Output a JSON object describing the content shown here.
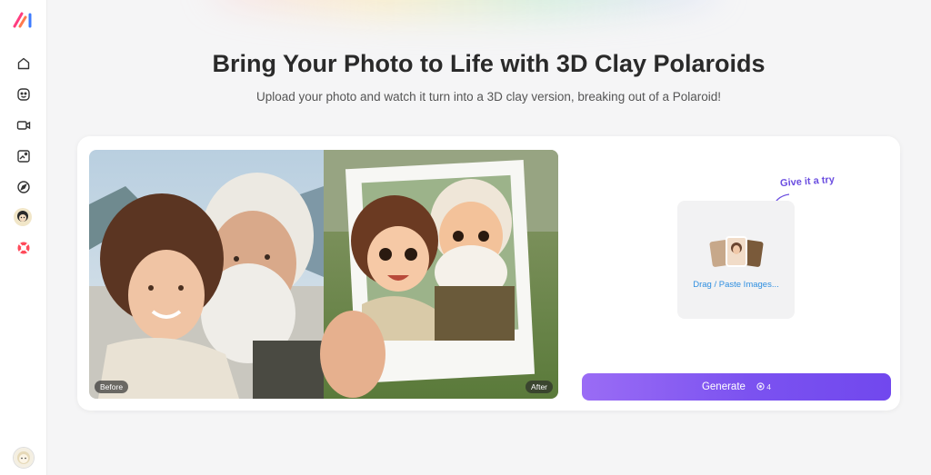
{
  "header": {
    "title": "Bring Your Photo to Life with 3D Clay Polaroids",
    "subtitle": "Upload your photo and watch it turn into a 3D clay version, breaking out of a Polaroid!"
  },
  "sidebar": {
    "items": [
      {
        "icon": "home-icon"
      },
      {
        "icon": "face-icon"
      },
      {
        "icon": "video-icon"
      },
      {
        "icon": "image-edit-icon"
      },
      {
        "icon": "compass-icon"
      },
      {
        "icon": "avatar-icon"
      },
      {
        "icon": "lifebuoy-icon"
      }
    ]
  },
  "comparison": {
    "before_label": "Before",
    "after_label": "After"
  },
  "upload": {
    "hint": "Give it a try",
    "drop_label": "Drag / Paste Images..."
  },
  "generate": {
    "label": "Generate",
    "cost": "4",
    "cost_icon": "credit-icon"
  },
  "colors": {
    "accent": "#7b52f0",
    "link": "#2f8fe0",
    "background": "#f5f5f6"
  }
}
